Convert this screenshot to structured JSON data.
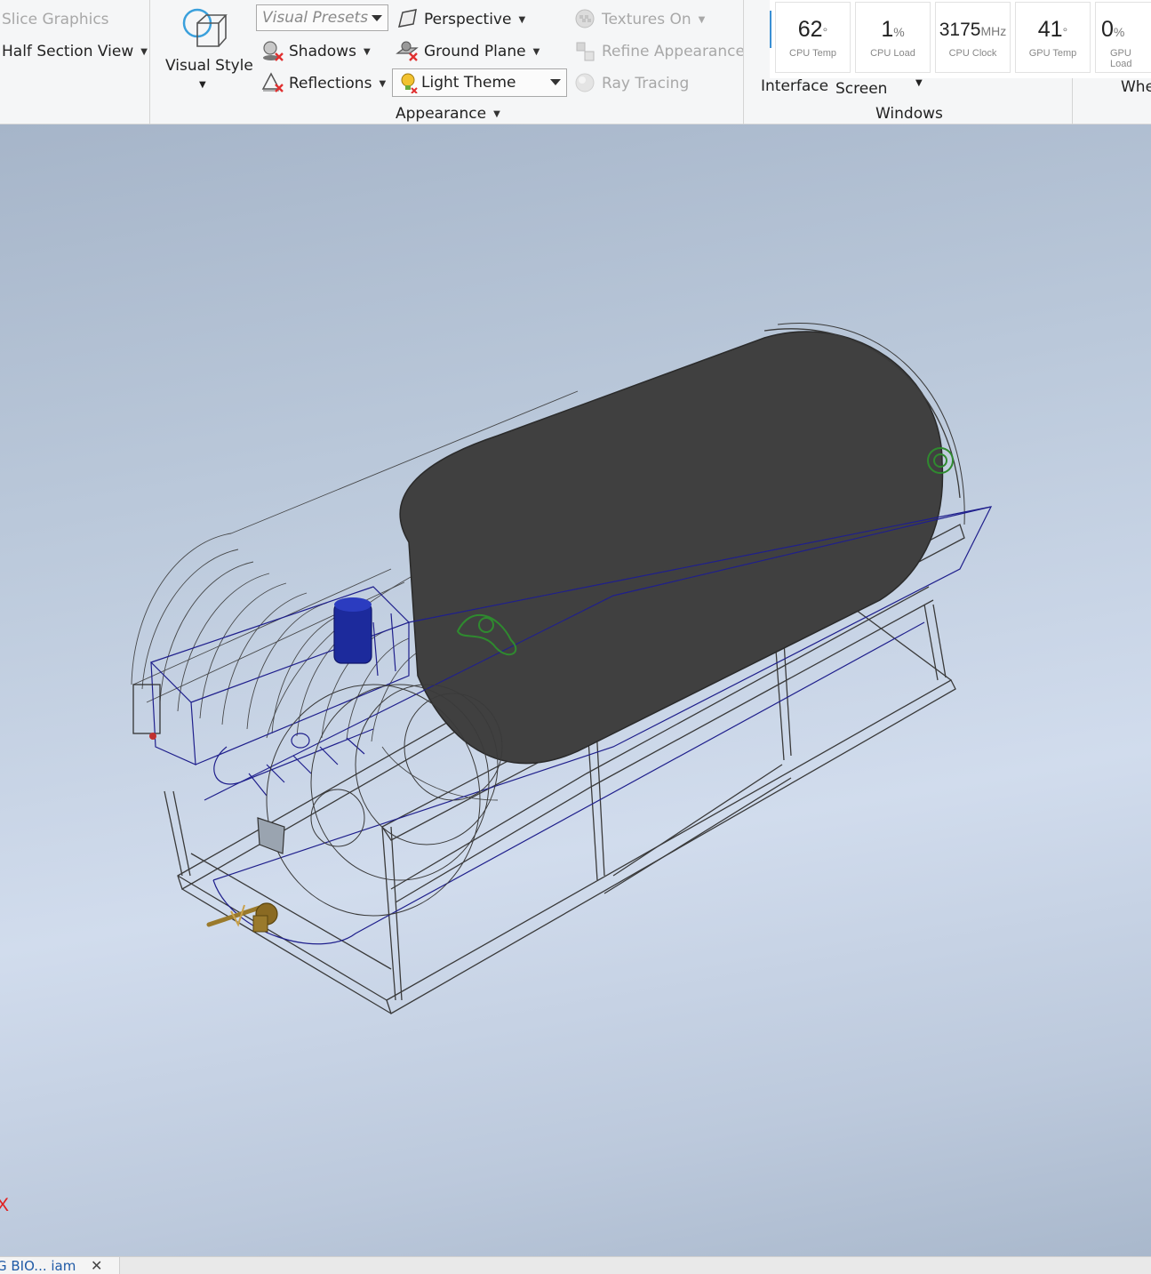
{
  "ribbon": {
    "section_left": {
      "slice_graphics": "Slice Graphics",
      "half_section_view": "Half Section View"
    },
    "visual_style": {
      "label": "Visual Style"
    },
    "appearance": {
      "visual_presets": "Visual Presets",
      "shadows": "Shadows",
      "reflections": "Reflections",
      "perspective": "Perspective",
      "ground_plane": "Ground Plane",
      "light_theme": "Light Theme",
      "textures_on": "Textures On",
      "refine_appearance": "Refine Appearance",
      "ray_tracing": "Ray Tracing",
      "panel_label": "Appearance"
    },
    "windows": {
      "interface": "Interface",
      "screen": "Screen",
      "panel_label": "Windows",
      "wheel_partial": "Whe"
    },
    "monitor": [
      {
        "value": "62",
        "unit": "°",
        "caption": "CPU Temp"
      },
      {
        "value": "1",
        "unit": "%",
        "caption": "CPU Load"
      },
      {
        "value": "3175",
        "unit": "MHz",
        "caption": "CPU Clock"
      },
      {
        "value": "41",
        "unit": "°",
        "caption": "GPU Temp"
      },
      {
        "value": "0",
        "unit": "%",
        "caption": "GPU Load"
      }
    ]
  },
  "viewport": {
    "axis_marker": "X"
  },
  "tabs": {
    "document_tab": "G BIO... iam",
    "close_glyph": "✕"
  },
  "colors": {
    "ribbon_bg": "#f5f6f7",
    "tank_fill": "#404040",
    "wire_dark": "#3a3a3a",
    "wire_blue": "#1f1f8c",
    "accent_green": "#2f8a2f",
    "brass": "#9a7a2c",
    "axis_red": "#e02020"
  }
}
